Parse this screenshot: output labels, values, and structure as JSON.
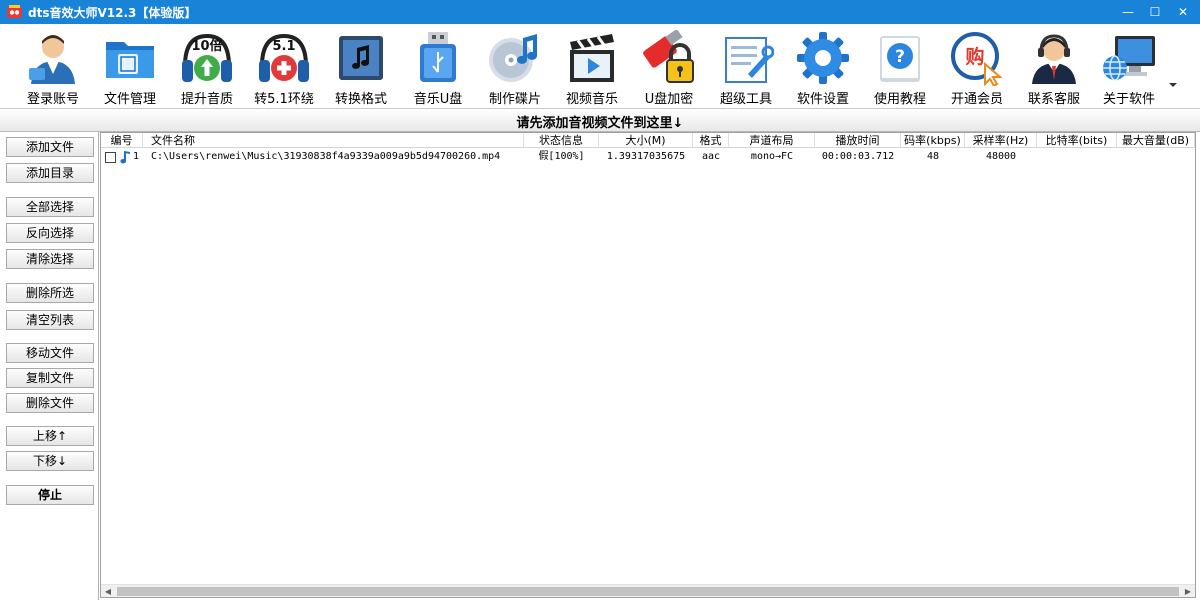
{
  "window": {
    "title": "dts音效大师V12.3【体验版】",
    "controls": {
      "minimize": "—",
      "maximize": "☐",
      "close": "✕"
    }
  },
  "toolbar": {
    "items": [
      {
        "label": "登录账号",
        "icon": "user-login-icon"
      },
      {
        "label": "文件管理",
        "icon": "folder-icon"
      },
      {
        "label": "提升音质",
        "icon": "headphones-boost-icon",
        "badge": "10倍"
      },
      {
        "label": "转5.1环绕",
        "icon": "headphones-surround-icon",
        "badge": "5.1"
      },
      {
        "label": "转换格式",
        "icon": "music-convert-icon"
      },
      {
        "label": "音乐U盘",
        "icon": "usb-drive-icon"
      },
      {
        "label": "制作碟片",
        "icon": "music-disc-icon"
      },
      {
        "label": "视频音乐",
        "icon": "clapperboard-icon"
      },
      {
        "label": "U盘加密",
        "icon": "usb-lock-icon"
      },
      {
        "label": "超级工具",
        "icon": "tools-icon"
      },
      {
        "label": "软件设置",
        "icon": "gear-icon"
      },
      {
        "label": "使用教程",
        "icon": "help-book-icon"
      },
      {
        "label": "开通会员",
        "icon": "membership-icon",
        "badge": "购"
      },
      {
        "label": "联系客服",
        "icon": "customer-service-icon"
      },
      {
        "label": "关于软件",
        "icon": "computer-icon"
      }
    ]
  },
  "hint": "请先添加音视频文件到这里↓",
  "sidebar": {
    "buttons": [
      {
        "label": "添加文件"
      },
      {
        "label": "添加目录"
      },
      {
        "label": "全部选择"
      },
      {
        "label": "反向选择"
      },
      {
        "label": "清除选择"
      },
      {
        "label": "删除所选"
      },
      {
        "label": "清空列表"
      },
      {
        "label": "移动文件"
      },
      {
        "label": "复制文件"
      },
      {
        "label": "删除文件"
      },
      {
        "label": "上移↑"
      },
      {
        "label": "下移↓"
      },
      {
        "label": "停止"
      }
    ]
  },
  "table": {
    "columns": [
      "编号",
      "文件名称",
      "状态信息",
      "大小(M)",
      "格式",
      "声道布局",
      "播放时间",
      "码率(kbps)",
      "采样率(Hz)",
      "比特率(bits)",
      "最大音量(dB)"
    ],
    "rows": [
      {
        "no": "1",
        "name": "C:\\Users\\renwei\\Music\\31930838f4a9339a009a9b5d94700260.mp4",
        "status": "假[100%]",
        "size": "1.39317035675",
        "format": "aac",
        "channel": "mono→FC",
        "duration": "00:00:03.712",
        "bitrate": "48",
        "samplerate": "48000",
        "bits": "",
        "maxvol": ""
      }
    ]
  },
  "colors": {
    "titlebar": "#1883d7",
    "accent": "#1e73be"
  }
}
